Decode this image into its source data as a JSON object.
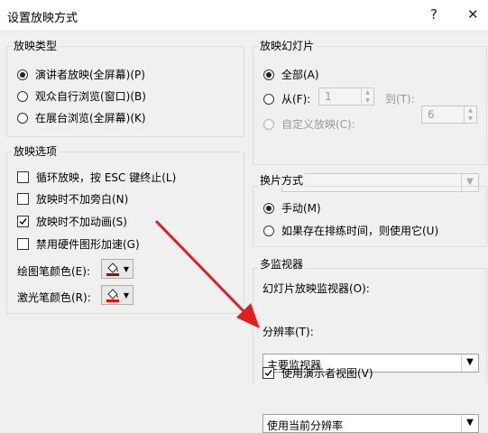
{
  "window": {
    "title": "设置放映方式",
    "help_label": "?",
    "close_label": "✕"
  },
  "show_type": {
    "title": "放映类型",
    "options": [
      {
        "label": "演讲者放映(全屏幕)(P)",
        "selected": true
      },
      {
        "label": "观众自行浏览(窗口)(B)",
        "selected": false
      },
      {
        "label": "在展台浏览(全屏幕)(K)",
        "selected": false
      }
    ]
  },
  "show_options": {
    "title": "放映选项",
    "checkboxes": [
      {
        "label": "循环放映，按 ESC 键终止(L)",
        "checked": false
      },
      {
        "label": "放映时不加旁白(N)",
        "checked": false
      },
      {
        "label": "放映时不加动画(S)",
        "checked": true
      },
      {
        "label": "禁用硬件图形加速(G)",
        "checked": false
      }
    ],
    "pen_color_label": "绘图笔颜色(E):",
    "laser_color_label": "激光笔颜色(R):",
    "pen_color": "#c00000",
    "laser_color": "#ff0000"
  },
  "show_slides": {
    "title": "放映幻灯片",
    "all_label": "全部(A)",
    "from_label": "从(F):",
    "from_value": "1",
    "to_label": "到(T):",
    "to_value": "6",
    "custom_label": "自定义放映(C):",
    "custom_value": ""
  },
  "advance": {
    "title": "换片方式",
    "manual_label": "手动(M)",
    "timings_label": "如果存在排练时间，则使用它(U)"
  },
  "monitors": {
    "title": "多监视器",
    "monitor_label": "幻灯片放映监视器(O):",
    "monitor_value": "主要监视器",
    "resolution_label": "分辨率(T):",
    "resolution_value": "使用当前分辨率",
    "presenter_view_label": "使用演示者视图(V)",
    "presenter_view_checked": true
  },
  "annotation": {
    "arrow_color": "#e02020"
  }
}
